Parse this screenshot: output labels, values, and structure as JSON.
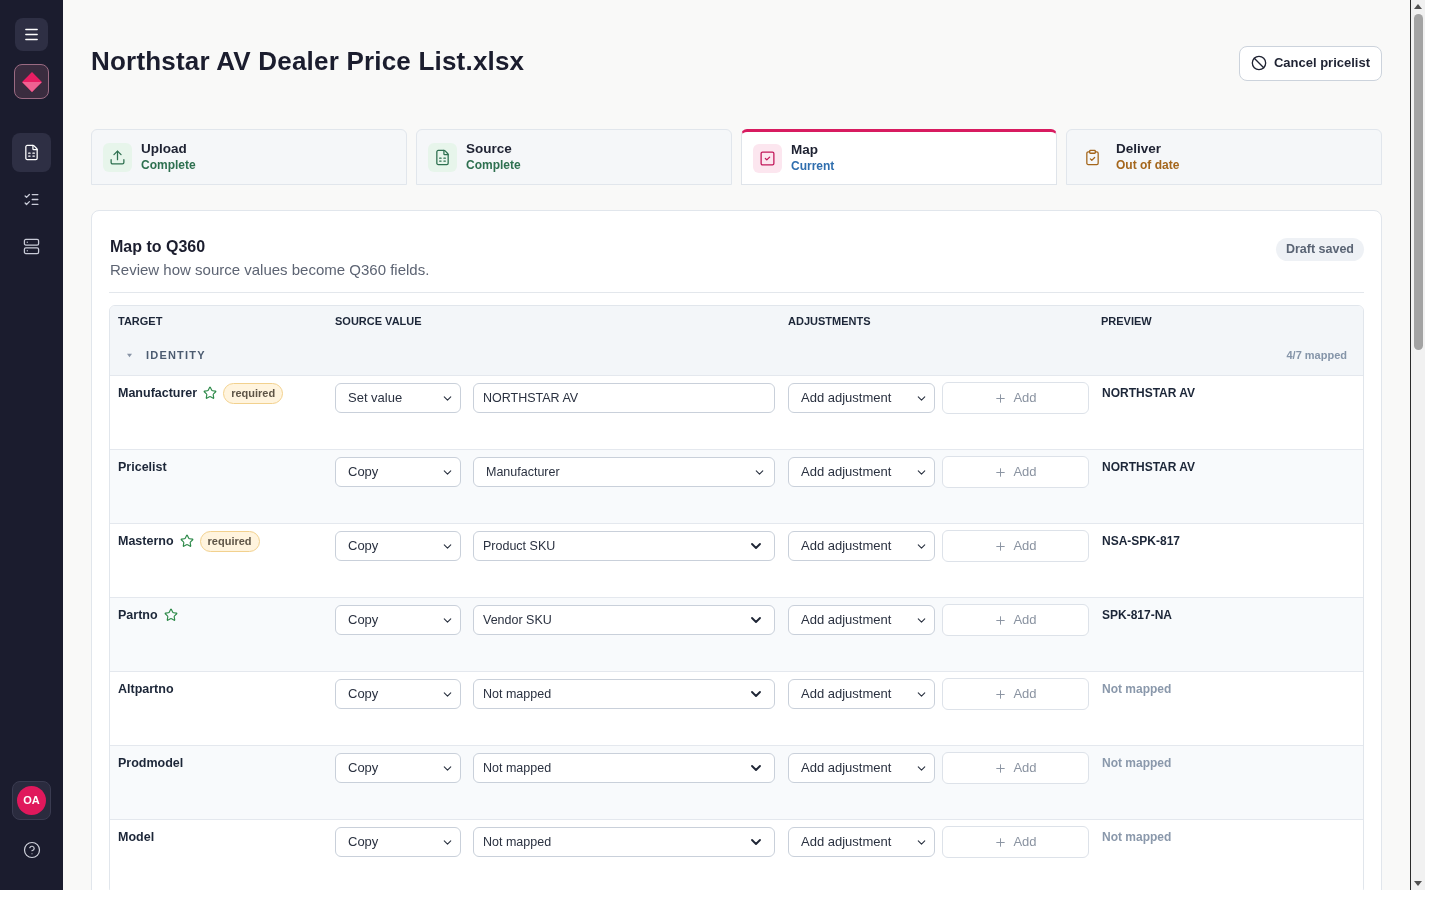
{
  "sidebar": {
    "nav": [
      {
        "selected": true
      },
      {
        "selected": false
      },
      {
        "selected": false
      }
    ],
    "avatar": "OA"
  },
  "header": {
    "title": "Northstar AV Dealer Price List.xlsx",
    "cancel_button": "Cancel pricelist"
  },
  "steps": [
    {
      "label": "Upload",
      "status": "Complete",
      "kind": "complete",
      "selected": false
    },
    {
      "label": "Source",
      "status": "Complete",
      "kind": "complete",
      "selected": false
    },
    {
      "label": "Map",
      "status": "Current",
      "kind": "current",
      "selected": true
    },
    {
      "label": "Deliver",
      "status": "Out of date",
      "kind": "outdated",
      "selected": false
    }
  ],
  "panel": {
    "title": "Map to Q360",
    "subtitle": "Review how source values become Q360 fields.",
    "badge": "Draft saved"
  },
  "table": {
    "columns": [
      "TARGET",
      "SOURCE VALUE",
      "ADJUSTMENTS",
      "PREVIEW"
    ],
    "groups": [
      {
        "label": "IDENTITY",
        "expanded": true,
        "count": "4/7 mapped",
        "rows": [
          {
            "target": "Manufacturer",
            "starred": true,
            "badge": "required",
            "mode": "Set value",
            "source": {
              "kind": "input",
              "value": "NORTHSTAR AV"
            },
            "adjustment": "Add adjustment",
            "add": "Add",
            "preview": "NORTHSTAR AV",
            "mapped": true
          },
          {
            "target": "Pricelist",
            "starred": false,
            "mode": "Copy",
            "source": {
              "kind": "select",
              "value": "Manufacturer"
            },
            "adjustment": "Add adjustment",
            "add": "Add",
            "preview": "NORTHSTAR AV",
            "mapped": true
          },
          {
            "target": "Masterno",
            "starred": true,
            "badge": "required",
            "mode": "Copy",
            "source": {
              "kind": "combo",
              "value": "Product SKU"
            },
            "adjustment": "Add adjustment",
            "add": "Add",
            "preview": "NSA-SPK-817",
            "mapped": true
          },
          {
            "target": "Partno",
            "starred": true,
            "mode": "Copy",
            "source": {
              "kind": "combo",
              "value": "Vendor SKU"
            },
            "adjustment": "Add adjustment",
            "add": "Add",
            "preview": "SPK-817-NA",
            "mapped": true
          },
          {
            "target": "Altpartno",
            "starred": false,
            "mode": "Copy",
            "source": {
              "kind": "combo",
              "value": "Not mapped"
            },
            "adjustment": "Add adjustment",
            "add": "Add",
            "preview": "Not mapped",
            "mapped": false
          },
          {
            "target": "Prodmodel",
            "starred": false,
            "mode": "Copy",
            "source": {
              "kind": "combo",
              "value": "Not mapped"
            },
            "adjustment": "Add adjustment",
            "add": "Add",
            "preview": "Not mapped",
            "mapped": false
          },
          {
            "target": "Model",
            "starred": false,
            "mode": "Copy",
            "source": {
              "kind": "combo",
              "value": "Not mapped"
            },
            "adjustment": "Add adjustment",
            "add": "Add",
            "preview": "Not mapped",
            "mapped": false
          }
        ]
      }
    ]
  }
}
